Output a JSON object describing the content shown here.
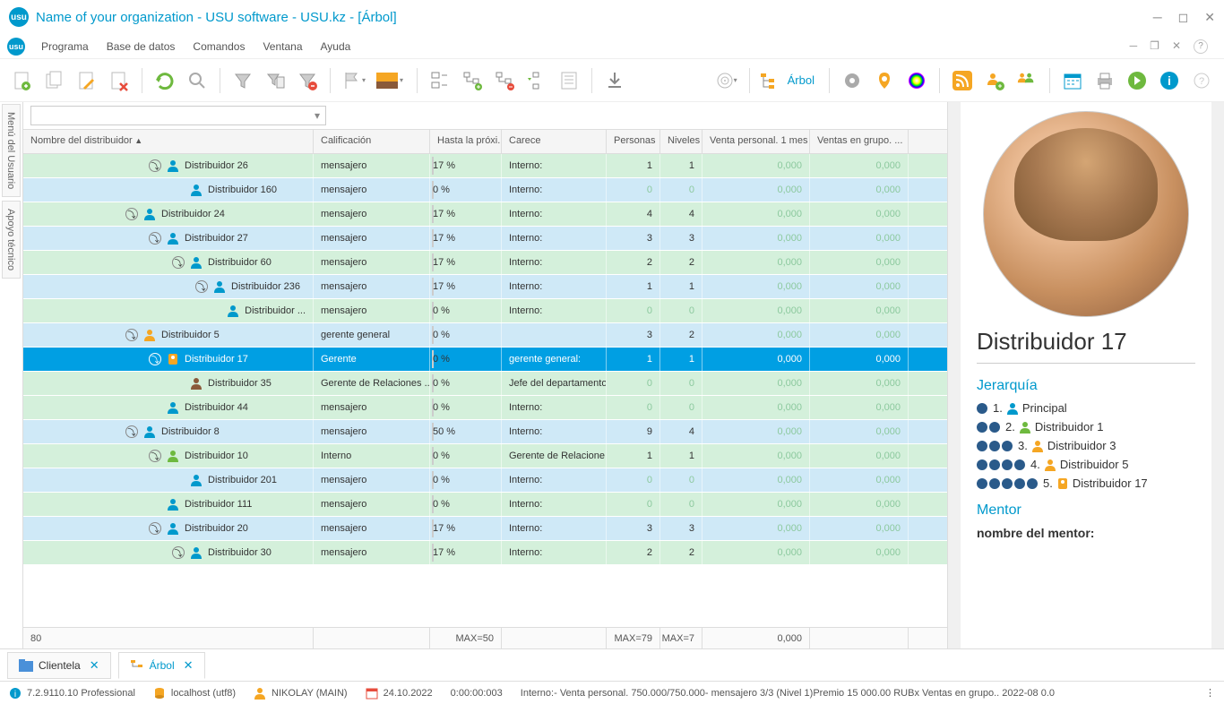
{
  "window": {
    "title": "Name of your organization - USU software - USU.kz - [Árbol]"
  },
  "menu": {
    "items": [
      "Programa",
      "Base de datos",
      "Comandos",
      "Ventana",
      "Ayuda"
    ]
  },
  "toolbar": {
    "arbol_label": "Árbol"
  },
  "side_tabs": [
    "Menú del Usuario",
    "Apoyo técnico"
  ],
  "columns": {
    "name": "Nombre del distribuidor",
    "cal": "Calificación",
    "hasta": "Hasta la próxi...",
    "carece": "Carece",
    "pers": "Personas",
    "niv": "Niveles",
    "vp": "Venta personal. 1 mes",
    "vg": "Ventas en grupo. ..."
  },
  "rows": [
    {
      "indent": 5,
      "exp": true,
      "icon": "person-blue",
      "name": "Distribuidor 26",
      "cal": "mensajero",
      "prog": 17,
      "progtext": "17 %",
      "carece": "Interno:",
      "pers": "1",
      "niv": "1",
      "vp": "0,000",
      "vg": "0,000",
      "color": "green"
    },
    {
      "indent": 6,
      "exp": false,
      "icon": "person-blue",
      "name": "Distribuidor 160",
      "cal": "mensajero",
      "prog": 0,
      "progtext": "0 %",
      "carece": "Interno:",
      "pers": "0",
      "niv": "0",
      "vp": "0,000",
      "vg": "0,000",
      "color": "blue",
      "zero": true
    },
    {
      "indent": 4,
      "exp": true,
      "icon": "person-blue",
      "name": "Distribuidor 24",
      "cal": "mensajero",
      "prog": 17,
      "progtext": "17 %",
      "carece": "Interno:",
      "pers": "4",
      "niv": "4",
      "vp": "0,000",
      "vg": "0,000",
      "color": "green"
    },
    {
      "indent": 5,
      "exp": true,
      "icon": "person-blue",
      "name": "Distribuidor 27",
      "cal": "mensajero",
      "prog": 17,
      "progtext": "17 %",
      "carece": "Interno:",
      "pers": "3",
      "niv": "3",
      "vp": "0,000",
      "vg": "0,000",
      "color": "blue"
    },
    {
      "indent": 6,
      "exp": true,
      "icon": "person-blue",
      "name": "Distribuidor 60",
      "cal": "mensajero",
      "prog": 17,
      "progtext": "17 %",
      "carece": "Interno:",
      "pers": "2",
      "niv": "2",
      "vp": "0,000",
      "vg": "0,000",
      "color": "green"
    },
    {
      "indent": 7,
      "exp": true,
      "icon": "person-blue",
      "name": "Distribuidor 236",
      "cal": "mensajero",
      "prog": 17,
      "progtext": "17 %",
      "carece": "Interno:",
      "pers": "1",
      "niv": "1",
      "vp": "0,000",
      "vg": "0,000",
      "color": "blue"
    },
    {
      "indent": 8,
      "exp": false,
      "icon": "person-blue",
      "name": "Distribuidor ...",
      "cal": "mensajero",
      "prog": 0,
      "progtext": "0 %",
      "carece": "Interno:",
      "pers": "0",
      "niv": "0",
      "vp": "0,000",
      "vg": "0,000",
      "color": "green",
      "zero": true
    },
    {
      "indent": 4,
      "exp": true,
      "icon": "person-orange",
      "name": "Distribuidor 5",
      "cal": "gerente general",
      "prog": 0,
      "progtext": "0 %",
      "carece": "",
      "pers": "3",
      "niv": "2",
      "vp": "0,000",
      "vg": "0,000",
      "color": "blue"
    },
    {
      "indent": 5,
      "exp": true,
      "icon": "badge",
      "name": "Distribuidor 17",
      "cal": "Gerente",
      "prog": 0,
      "progtext": "0 %",
      "carece": "gerente general:",
      "pers": "1",
      "niv": "1",
      "vp": "0,000",
      "vg": "0,000",
      "color": "sel"
    },
    {
      "indent": 6,
      "exp": false,
      "icon": "person-suit",
      "name": "Distribuidor 35",
      "cal": "Gerente de Relaciones ...",
      "prog": 0,
      "progtext": "0 %",
      "carece": "Jefe del departamento:",
      "pers": "0",
      "niv": "0",
      "vp": "0,000",
      "vg": "0,000",
      "color": "green",
      "zero": true
    },
    {
      "indent": 5,
      "exp": false,
      "icon": "person-blue",
      "name": "Distribuidor 44",
      "cal": "mensajero",
      "prog": 0,
      "progtext": "0 %",
      "carece": "Interno:",
      "pers": "0",
      "niv": "0",
      "vp": "0,000",
      "vg": "0,000",
      "color": "green",
      "zero": true
    },
    {
      "indent": 4,
      "exp": true,
      "icon": "person-blue",
      "name": "Distribuidor 8",
      "cal": "mensajero",
      "prog": 50,
      "progtext": "50 %",
      "carece": "Interno:",
      "pers": "9",
      "niv": "4",
      "vp": "0,000",
      "vg": "0,000",
      "color": "blue"
    },
    {
      "indent": 5,
      "exp": true,
      "icon": "person-green",
      "name": "Distribuidor 10",
      "cal": "Interno",
      "prog": 0,
      "progtext": "0 %",
      "carece": "Gerente de Relacione...",
      "pers": "1",
      "niv": "1",
      "vp": "0,000",
      "vg": "0,000",
      "color": "green"
    },
    {
      "indent": 6,
      "exp": false,
      "icon": "person-blue",
      "name": "Distribuidor 201",
      "cal": "mensajero",
      "prog": 0,
      "progtext": "0 %",
      "carece": "Interno:",
      "pers": "0",
      "niv": "0",
      "vp": "0,000",
      "vg": "0,000",
      "color": "blue",
      "zero": true
    },
    {
      "indent": 5,
      "exp": false,
      "icon": "person-blue",
      "name": "Distribuidor 111",
      "cal": "mensajero",
      "prog": 0,
      "progtext": "0 %",
      "carece": "Interno:",
      "pers": "0",
      "niv": "0",
      "vp": "0,000",
      "vg": "0,000",
      "color": "green",
      "zero": true
    },
    {
      "indent": 5,
      "exp": true,
      "icon": "person-blue",
      "name": "Distribuidor 20",
      "cal": "mensajero",
      "prog": 17,
      "progtext": "17 %",
      "carece": "Interno:",
      "pers": "3",
      "niv": "3",
      "vp": "0,000",
      "vg": "0,000",
      "color": "blue"
    },
    {
      "indent": 6,
      "exp": true,
      "icon": "person-blue",
      "name": "Distribuidor 30",
      "cal": "mensajero",
      "prog": 17,
      "progtext": "17 %",
      "carece": "Interno:",
      "pers": "2",
      "niv": "2",
      "vp": "0,000",
      "vg": "0,000",
      "color": "green"
    }
  ],
  "footer": {
    "count": "80",
    "max_prog": "MAX=50",
    "max_pers": "MAX=79",
    "max_niv": "MAX=7",
    "vp": "0,000"
  },
  "detail": {
    "title": "Distribuidor 17",
    "hierarchy_title": "Jerarquía",
    "hierarchy": [
      {
        "dots": 1,
        "num": "1.",
        "icon": "person-blue",
        "label": "Principal"
      },
      {
        "dots": 2,
        "num": "2.",
        "icon": "person-green",
        "label": "Distribuidor 1"
      },
      {
        "dots": 3,
        "num": "3.",
        "icon": "person-orange",
        "label": "Distribuidor 3"
      },
      {
        "dots": 4,
        "num": "4.",
        "icon": "person-orange",
        "label": "Distribuidor 5"
      },
      {
        "dots": 5,
        "num": "5.",
        "icon": "badge",
        "label": "Distribuidor 17"
      }
    ],
    "mentor_title": "Mentor",
    "mentor_label": "nombre del mentor:"
  },
  "bottom_tabs": [
    {
      "label": "Clientela",
      "active": false
    },
    {
      "label": "Árbol",
      "active": true
    }
  ],
  "status": {
    "version": "7.2.9110.10 Professional",
    "db": "localhost (utf8)",
    "user": "NIKOLAY (MAIN)",
    "date": "24.10.2022",
    "time": "0:00:00:003",
    "info": "Interno:- Venta personal. 750.000/750.000- mensajero 3/3 (Nivel 1)Premio 15 000.00 RUBx   Ventas en grupo..  2022-08 0.0"
  }
}
